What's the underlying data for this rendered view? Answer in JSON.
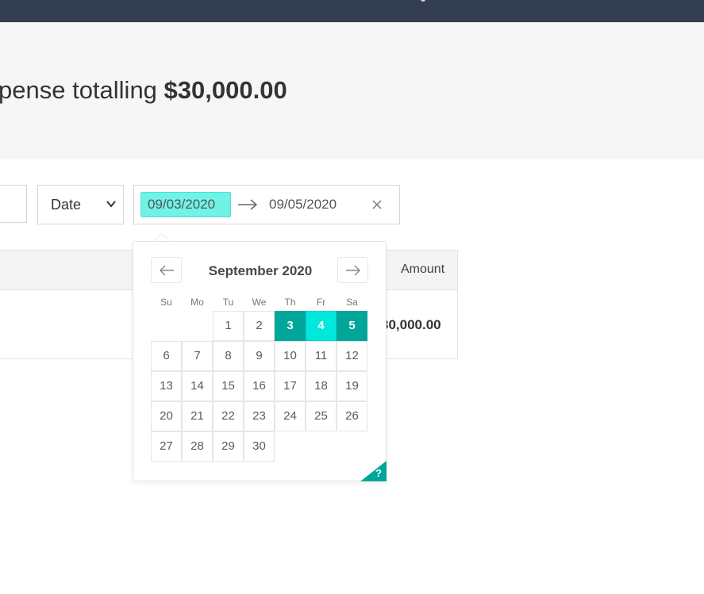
{
  "summary": {
    "prefix": "pense totalling ",
    "total": "$30,000.00"
  },
  "filters": {
    "sort_select": {
      "selected": "Date"
    },
    "date_range": {
      "start": "09/03/2020",
      "end": "09/05/2020"
    }
  },
  "table": {
    "amount_header": "Amount",
    "rows": [
      {
        "amount": "30,000.00"
      }
    ]
  },
  "calendar": {
    "month_title": "September 2020",
    "weekdays": [
      "Su",
      "Mo",
      "Tu",
      "We",
      "Th",
      "Fr",
      "Sa"
    ],
    "days": [
      "1",
      "2",
      "3",
      "4",
      "5",
      "6",
      "7",
      "8",
      "9",
      "10",
      "11",
      "12",
      "13",
      "14",
      "15",
      "16",
      "17",
      "18",
      "19",
      "20",
      "21",
      "22",
      "23",
      "24",
      "25",
      "26",
      "27",
      "28",
      "29",
      "30"
    ],
    "first_weekday_index": 2,
    "selected_start": 3,
    "selected_end": 5,
    "help_label": "?",
    "colors": {
      "selected_edge": "#00a699",
      "selected_span": "#00e8dc"
    }
  },
  "icons": {
    "prev": "arrow-left-icon",
    "next": "arrow-right-icon",
    "range_arrow": "arrow-right-icon",
    "clear": "close-icon",
    "select": "chevron-down-icon"
  }
}
